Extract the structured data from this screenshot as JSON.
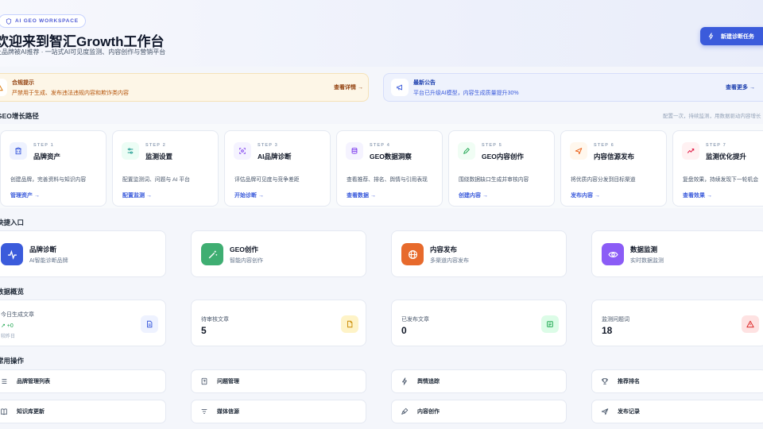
{
  "header": {
    "chip": "AI GEO WORKSPACE",
    "title": "欢迎来到智汇Growth工作台",
    "subtitle": "让品牌被AI推荐 · 一站式AI可见度监测、内容创作与营销平台",
    "new_task": "新建诊断任务"
  },
  "notices": [
    {
      "title": "合规提示",
      "desc": "严禁用于生成、发布违法违规内容和欺诈类内容",
      "link": "查看详情 →"
    },
    {
      "title": "最新公告",
      "desc": "平台已升级AI模型，内容生成质量提升30%",
      "link": "查看更多 →"
    }
  ],
  "growth": {
    "title": "GEO增长路径",
    "note": "配置一次，持续监测，用数据驱动内容增长",
    "steps": [
      {
        "num": "STEP 1",
        "title": "品牌资产",
        "desc": "创建品牌，完善资料与知识内容",
        "link": "管理资产 →",
        "color": "#3b5bdb",
        "bg": "#eef2ff",
        "icon": "building-icon"
      },
      {
        "num": "STEP 2",
        "title": "监测设置",
        "desc": "配置监测词、问题与 AI 平台",
        "link": "配置监测 →",
        "color": "#0d9488",
        "bg": "#ecfdf5",
        "icon": "sliders-icon"
      },
      {
        "num": "STEP 3",
        "title": "AI品牌诊断",
        "desc": "评估品牌可见度与竞争差距",
        "link": "开始诊断 →",
        "color": "#7c3aed",
        "bg": "#f5f3ff",
        "icon": "scan-icon"
      },
      {
        "num": "STEP 4",
        "title": "GEO数据洞察",
        "desc": "查看推荐、排名、舆情与引用表现",
        "link": "查看数据 →",
        "color": "#7c3aed",
        "bg": "#f5f3ff",
        "icon": "database-icon"
      },
      {
        "num": "STEP 5",
        "title": "GEO内容创作",
        "desc": "围绕数据缺口生成并审核内容",
        "link": "创建内容 →",
        "color": "#16a34a",
        "bg": "#f0fdf4",
        "icon": "pen-icon"
      },
      {
        "num": "STEP 6",
        "title": "内容信源发布",
        "desc": "将优质内容分发到目标渠道",
        "link": "发布内容 →",
        "color": "#ea580c",
        "bg": "#fff7ed",
        "icon": "send-icon"
      },
      {
        "num": "STEP 7",
        "title": "监测优化提升",
        "desc": "复盘效果，持续发现下一轮机会",
        "link": "查看效果 →",
        "color": "#e11d48",
        "bg": "#fff1f2",
        "icon": "trend-up-icon"
      }
    ]
  },
  "quick": {
    "title": "快捷入口",
    "items": [
      {
        "title": "品牌诊断",
        "sub": "AI智能诊断品牌",
        "color": "#3b5bdb",
        "icon": "pulse-icon"
      },
      {
        "title": "GEO创作",
        "sub": "智能内容创作",
        "color": "#3fae72",
        "icon": "magic-wand-icon"
      },
      {
        "title": "内容发布",
        "sub": "多渠道内容发布",
        "color": "#e76a2c",
        "icon": "globe-icon"
      },
      {
        "title": "数据监测",
        "sub": "实时数据监测",
        "color": "#8b5cf6",
        "icon": "eye-icon"
      }
    ]
  },
  "overview": {
    "title": "数据概览",
    "stats": [
      {
        "label": "今日生成文章",
        "value": "",
        "trend": "↗ +0",
        "foot": "较昨日",
        "color": "#3b5bdb",
        "bg": "#eef2ff",
        "icon": "document-icon"
      },
      {
        "label": "待审核文章",
        "value": "5",
        "trend": "",
        "foot": "",
        "color": "#ca8a04",
        "bg": "#fef3c7",
        "icon": "file-pending-icon"
      },
      {
        "label": "已发布文章",
        "value": "0",
        "trend": "",
        "foot": "",
        "color": "#16a34a",
        "bg": "#dcfce7",
        "icon": "newspaper-icon"
      },
      {
        "label": "监测问题词",
        "value": "18",
        "trend": "",
        "foot": "",
        "color": "#dc2626",
        "bg": "#fee2e2",
        "icon": "warning-icon"
      }
    ]
  },
  "actions": {
    "title": "常用操作",
    "items": [
      {
        "label": "品牌管理列表",
        "icon": "list-icon"
      },
      {
        "label": "问题管理",
        "icon": "question-file-icon"
      },
      {
        "label": "舆情追踪",
        "icon": "bolt-icon"
      },
      {
        "label": "推荐排名",
        "icon": "trophy-icon"
      },
      {
        "label": "知识库更新",
        "icon": "book-icon"
      },
      {
        "label": "媒体信源",
        "icon": "filter-icon"
      },
      {
        "label": "内容创作",
        "icon": "pen-nib-icon"
      },
      {
        "label": "发布记录",
        "icon": "paper-plane-icon"
      }
    ]
  }
}
